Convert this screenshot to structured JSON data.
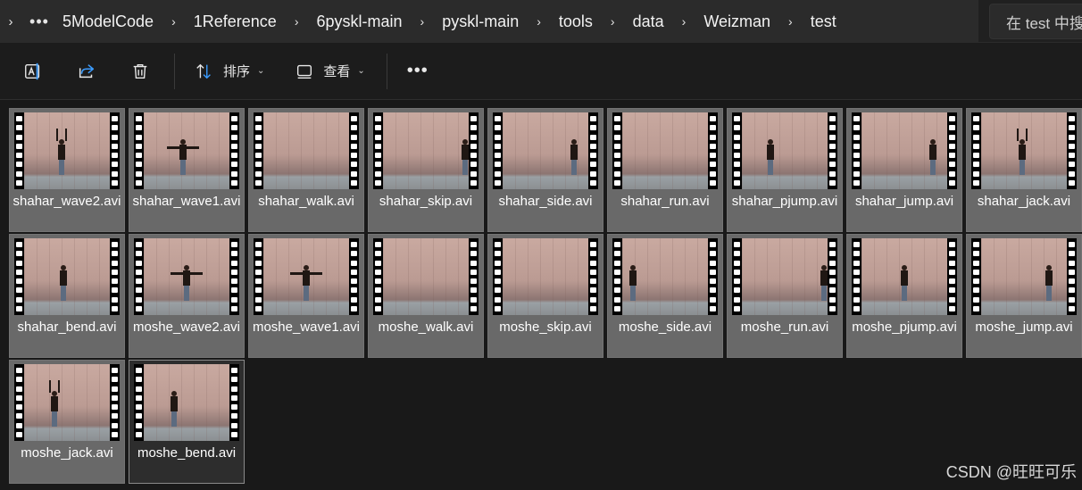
{
  "breadcrumb": {
    "nav_glyph": "›",
    "more_glyph": "•••",
    "separator": "›",
    "items": [
      "5ModelCode",
      "1Reference",
      "6pyskl-main",
      "pyskl-main",
      "tools",
      "data",
      "Weizman",
      "test"
    ]
  },
  "search": {
    "placeholder": "在 test 中搜"
  },
  "toolbar": {
    "sort_label": "排序",
    "view_label": "查看",
    "chevron": "⌄",
    "more": "•••"
  },
  "files": [
    {
      "name": "shahar_wave2.avi",
      "pose": "up",
      "pos": 38
    },
    {
      "name": "shahar_wave1.avi",
      "pose": "arms",
      "pos": 40
    },
    {
      "name": "shahar_walk.avi",
      "pose": "none",
      "pos": 0
    },
    {
      "name": "shahar_skip.avi",
      "pose": "edge",
      "pos": 92
    },
    {
      "name": "shahar_side.avi",
      "pose": "stand",
      "pos": 76
    },
    {
      "name": "shahar_run.avi",
      "pose": "none",
      "pos": 0
    },
    {
      "name": "shahar_pjump.avi",
      "pose": "stand",
      "pos": 28
    },
    {
      "name": "shahar_jump.avi",
      "pose": "stand",
      "pos": 76
    },
    {
      "name": "shahar_jack.avi",
      "pose": "up",
      "pos": 42
    },
    {
      "name": "shahar_bend.avi",
      "pose": "stand",
      "pos": 40
    },
    {
      "name": "moshe_wave2.avi",
      "pose": "arms",
      "pos": 44
    },
    {
      "name": "moshe_wave1.avi",
      "pose": "arms",
      "pos": 44
    },
    {
      "name": "moshe_walk.avi",
      "pose": "none",
      "pos": 0
    },
    {
      "name": "moshe_skip.avi",
      "pose": "none",
      "pos": 0
    },
    {
      "name": "moshe_side.avi",
      "pose": "stand",
      "pos": 8
    },
    {
      "name": "moshe_run.avi",
      "pose": "edge",
      "pos": 92
    },
    {
      "name": "moshe_pjump.avi",
      "pose": "stand",
      "pos": 44
    },
    {
      "name": "moshe_jump.avi",
      "pose": "stand",
      "pos": 72
    },
    {
      "name": "moshe_jack.avi",
      "pose": "up",
      "pos": 30
    },
    {
      "name": "moshe_bend.avi",
      "pose": "stand",
      "pos": 30,
      "selected": true
    }
  ],
  "watermark": "CSDN @旺旺可乐"
}
